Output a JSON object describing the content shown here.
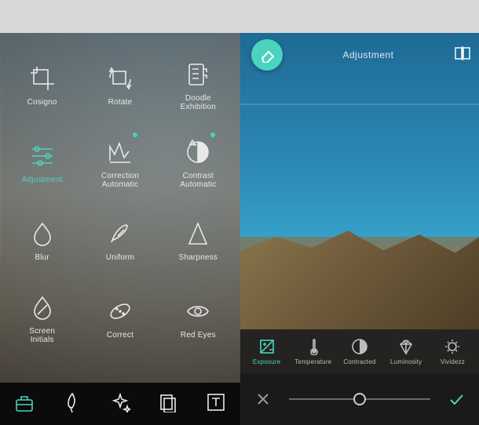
{
  "header": {
    "title": "Adjustment"
  },
  "tools": [
    {
      "id": "crop",
      "label": "Cosigno",
      "icon": "crop-icon",
      "active": false,
      "dot": false
    },
    {
      "id": "rotate",
      "label": "Rotate",
      "icon": "rotate-icon",
      "active": false,
      "dot": false
    },
    {
      "id": "doodle",
      "label": "Doodle\nExhibition",
      "icon": "doodle-icon",
      "active": false,
      "dot": false
    },
    {
      "id": "adjustment",
      "label": "Adjustment",
      "icon": "sliders-icon",
      "active": true,
      "dot": false
    },
    {
      "id": "auto-correct",
      "label": "Correction\nAutomatic",
      "icon": "auto-correct-icon",
      "active": false,
      "dot": true
    },
    {
      "id": "auto-contrast",
      "label": "Contrast\nAutomatic",
      "icon": "auto-contrast-icon",
      "active": false,
      "dot": true
    },
    {
      "id": "blur",
      "label": "Blur",
      "icon": "blur-icon",
      "active": false,
      "dot": false
    },
    {
      "id": "uniform",
      "label": "Uniform",
      "icon": "feather-icon",
      "active": false,
      "dot": false
    },
    {
      "id": "sharpness",
      "label": "Sharpness",
      "icon": "sharpen-icon",
      "active": false,
      "dot": false
    },
    {
      "id": "screen",
      "label": "Screen\nInitials",
      "icon": "drop-icon",
      "active": false,
      "dot": false
    },
    {
      "id": "correct",
      "label": "Correct",
      "icon": "patch-icon",
      "active": false,
      "dot": false
    },
    {
      "id": "redeye",
      "label": "Red Eyes",
      "icon": "eye-icon",
      "active": false,
      "dot": false
    }
  ],
  "bottom_tabs": [
    {
      "id": "toolbox",
      "icon": "toolbox-icon",
      "active": true
    },
    {
      "id": "brush",
      "icon": "brush-icon",
      "active": false
    },
    {
      "id": "effects",
      "icon": "sparkle-icon",
      "active": false
    },
    {
      "id": "layers",
      "icon": "layers-icon",
      "active": false
    },
    {
      "id": "text",
      "icon": "text-icon",
      "active": false
    }
  ],
  "adjustments": [
    {
      "id": "exposure",
      "label": "Exposure",
      "icon": "exposure-icon",
      "active": true
    },
    {
      "id": "temperature",
      "label": "Temperature",
      "icon": "thermometer-icon",
      "active": false
    },
    {
      "id": "contrast",
      "label": "Contracted",
      "icon": "contrast-icon",
      "active": false
    },
    {
      "id": "luminosity",
      "label": "Luminosity",
      "icon": "diamond-icon",
      "active": false
    },
    {
      "id": "vividness",
      "label": "Vividezz",
      "icon": "sun-icon",
      "active": false
    }
  ],
  "slider": {
    "value": 0,
    "min": -100,
    "max": 100
  },
  "colors": {
    "accent": "#4ad4bf"
  }
}
